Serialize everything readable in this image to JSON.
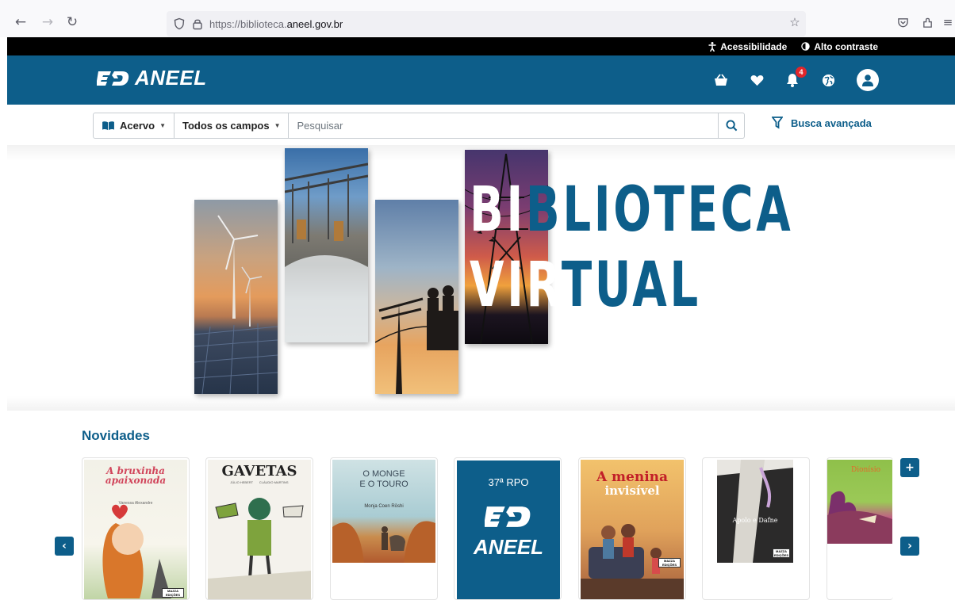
{
  "browser": {
    "url_prefix": "https://biblioteca.",
    "url_domain": "aneel.gov.br"
  },
  "access_bar": {
    "accessibility": "Acessibilidade",
    "contrast": "Alto contraste"
  },
  "header": {
    "logo_text": "ANEEL",
    "notification_count": "4",
    "brand_color": "#0d5e8a"
  },
  "search": {
    "collection_label": "Acervo",
    "fields_label": "Todos os campos",
    "placeholder": "Pesquisar",
    "advanced_label": "Busca avançada"
  },
  "banner": {
    "title_line1_white": "BI",
    "title_line1_blue": "BLIOTECA",
    "title_line2_white": "VIR",
    "title_line2_blue": "TUAL"
  },
  "news": {
    "title": "Novidades",
    "books": [
      {
        "cover_title_1": "A bruxinha",
        "cover_title_2": "apaixonada",
        "author": "Vanessa Alexandre",
        "publisher": "MAZZA EDIÇÕES"
      },
      {
        "cover_title": "GAVETAS",
        "authors": "JÚLIO HEBERT       CLÁUDIO MARTINS"
      },
      {
        "cover_title_1": "O MONGE",
        "cover_title_2": "E O TOURO",
        "author": "Monja Coen Rōshi"
      },
      {
        "cover_title": "37ª RPO",
        "logo_text": "ANEEL"
      },
      {
        "cover_title_1": "A menina",
        "cover_title_2": "invisível",
        "publisher": "MAZZA EDIÇÕES"
      },
      {
        "cover_title": "Apolo e Dafne",
        "publisher": "MAZZA EDIÇÕES"
      },
      {
        "cover_title": "Dionísio"
      }
    ]
  }
}
